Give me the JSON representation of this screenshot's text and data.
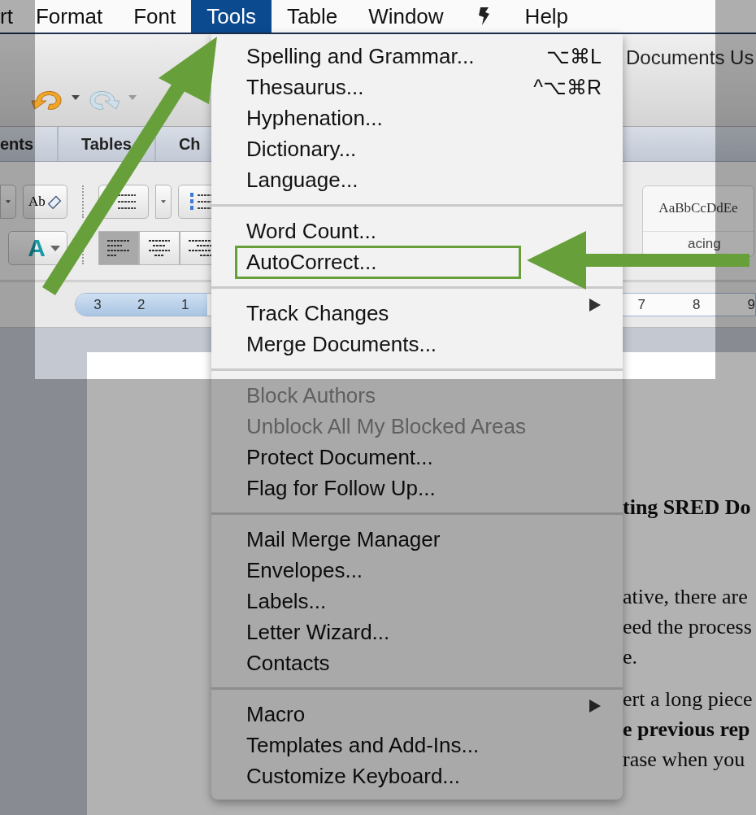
{
  "menu_bar": [
    {
      "kind": "text",
      "label": "rt",
      "selected": false
    },
    {
      "kind": "text",
      "label": "Format",
      "selected": false
    },
    {
      "kind": "text",
      "label": "Font",
      "selected": false
    },
    {
      "kind": "text",
      "label": "Tools",
      "selected": true
    },
    {
      "kind": "text",
      "label": "Table",
      "selected": false
    },
    {
      "kind": "text",
      "label": "Window",
      "selected": false
    },
    {
      "kind": "script",
      "selected": false
    },
    {
      "kind": "text",
      "label": "Help",
      "selected": false
    }
  ],
  "window_title": "Documents Us",
  "ribbon_tabs": [
    "ents",
    "Tables",
    "Ch"
  ],
  "ribbon": {
    "clear_button": "Ab",
    "text_effect_button": "A",
    "align_buttons": [
      {
        "selected": true
      },
      {
        "selected": false
      },
      {
        "selected": false
      }
    ],
    "style_gallery": {
      "sample": "AaBbCcDdEe",
      "name": "acing"
    }
  },
  "ruler": {
    "left_numbers": [
      "3",
      "2",
      "1"
    ],
    "right_numbers": [
      "7",
      "8",
      "9"
    ]
  },
  "document": {
    "paragraphs": [
      {
        "kind": "heading",
        "lines": [
          {
            "text": "ting SRED Do",
            "bold": true
          }
        ]
      },
      {
        "kind": "body",
        "lines": [
          {
            "text": "ative, there are",
            "bold": false
          },
          {
            "text": "eed the process",
            "bold": false
          },
          {
            "text": "e.",
            "bold": false
          }
        ]
      },
      {
        "kind": "body",
        "lines": [
          {
            "text": "ert a long piece",
            "bold": false
          },
          {
            "text": "e previous rep",
            "bold": true
          },
          {
            "text": "rase when you",
            "bold": false
          }
        ]
      }
    ]
  },
  "tools_menu": {
    "sections": [
      {
        "items": [
          {
            "label": "Spelling and Grammar...",
            "shortcut": "⌥⌘L",
            "submenu": false,
            "disabled": false,
            "highlighted": false
          },
          {
            "label": "Thesaurus...",
            "shortcut": "^⌥⌘R",
            "submenu": false,
            "disabled": false,
            "highlighted": false
          },
          {
            "label": "Hyphenation...",
            "submenu": false,
            "disabled": false,
            "highlighted": false
          },
          {
            "label": "Dictionary...",
            "submenu": false,
            "disabled": false,
            "highlighted": false
          },
          {
            "label": "Language...",
            "submenu": false,
            "disabled": false,
            "highlighted": false
          }
        ]
      },
      {
        "items": [
          {
            "label": "Word Count...",
            "submenu": false,
            "disabled": false,
            "highlighted": false
          },
          {
            "label": "AutoCorrect...",
            "submenu": false,
            "disabled": false,
            "highlighted": true
          }
        ]
      },
      {
        "items": [
          {
            "label": "Track Changes",
            "submenu": true,
            "disabled": false,
            "highlighted": false
          },
          {
            "label": "Merge Documents...",
            "submenu": false,
            "disabled": false,
            "highlighted": false
          }
        ]
      },
      {
        "items": [
          {
            "label": "Block Authors",
            "submenu": false,
            "disabled": true,
            "highlighted": false
          },
          {
            "label": "Unblock All My Blocked Areas",
            "submenu": false,
            "disabled": true,
            "highlighted": false
          },
          {
            "label": "Protect Document...",
            "submenu": false,
            "disabled": false,
            "highlighted": false
          },
          {
            "label": "Flag for Follow Up...",
            "submenu": false,
            "disabled": false,
            "highlighted": false
          }
        ]
      },
      {
        "items": [
          {
            "label": "Mail Merge Manager",
            "submenu": false,
            "disabled": false,
            "highlighted": false
          },
          {
            "label": "Envelopes...",
            "submenu": false,
            "disabled": false,
            "highlighted": false
          },
          {
            "label": "Labels...",
            "submenu": false,
            "disabled": false,
            "highlighted": false
          },
          {
            "label": "Letter Wizard...",
            "submenu": false,
            "disabled": false,
            "highlighted": false
          },
          {
            "label": "Contacts",
            "submenu": false,
            "disabled": false,
            "highlighted": false
          }
        ]
      },
      {
        "items": [
          {
            "label": "Macro",
            "submenu": true,
            "disabled": false,
            "highlighted": false
          },
          {
            "label": "Templates and Add-Ins...",
            "submenu": false,
            "disabled": false,
            "highlighted": false
          },
          {
            "label": "Customize Keyboard...",
            "submenu": false,
            "disabled": false,
            "highlighted": false
          }
        ]
      }
    ]
  }
}
